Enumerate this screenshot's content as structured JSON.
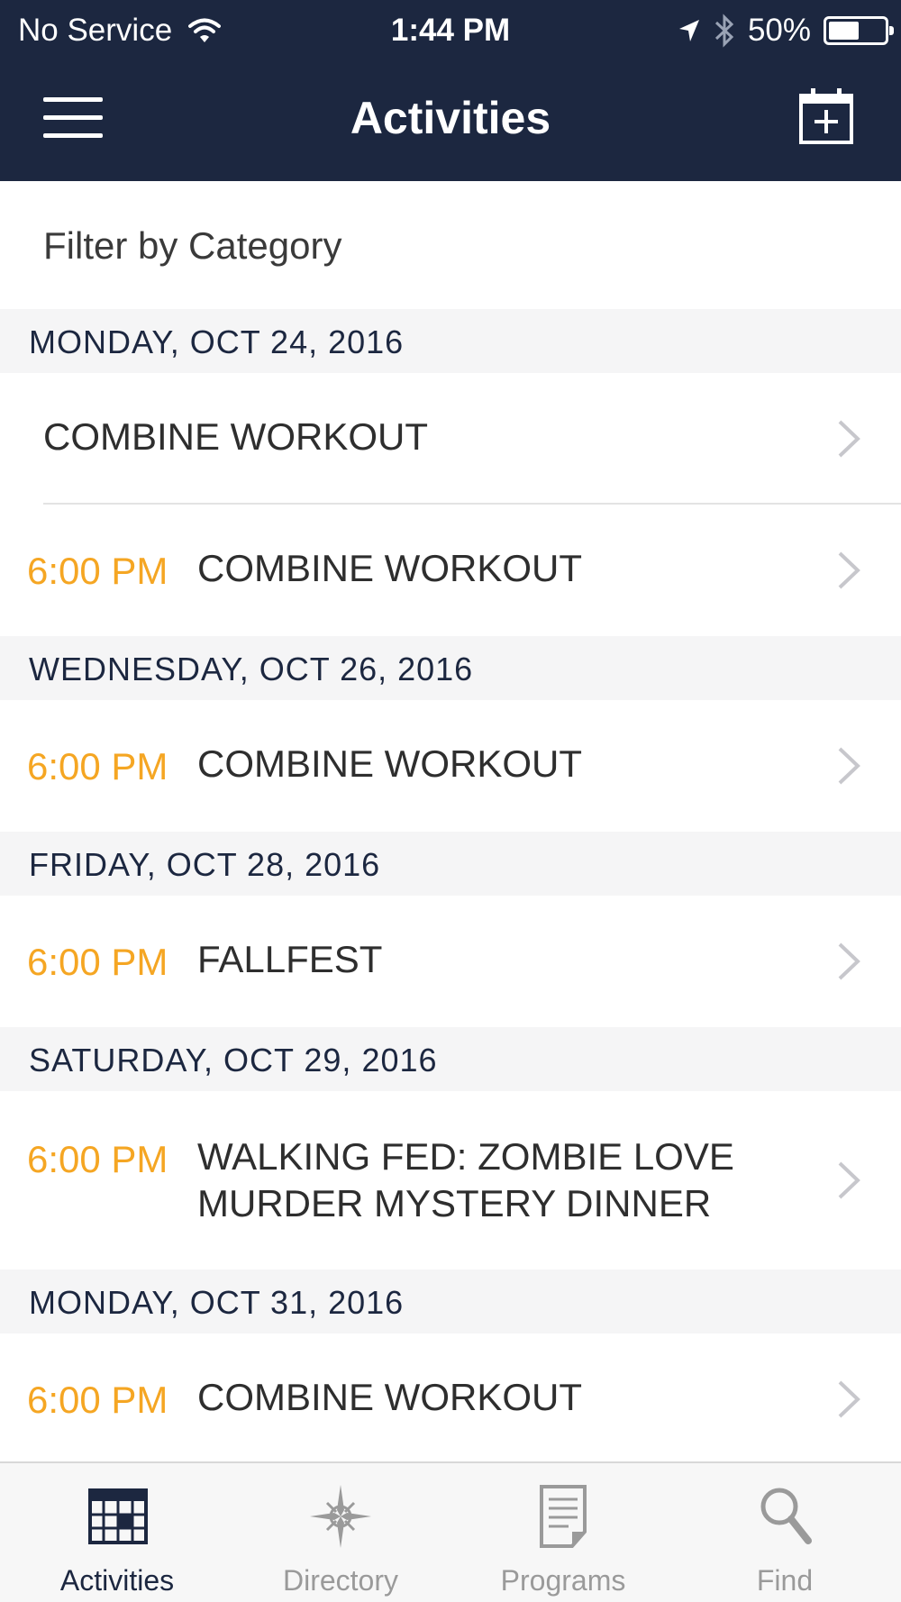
{
  "status_bar": {
    "carrier": "No Service",
    "time": "1:44 PM",
    "battery": "50%"
  },
  "nav": {
    "title": "Activities"
  },
  "filter": {
    "label": "Filter by Category"
  },
  "sections": [
    {
      "date": "MONDAY, OCT 24, 2016",
      "events": [
        {
          "time": "",
          "title": "COMBINE WORKOUT"
        },
        {
          "time": "6:00 PM",
          "title": "COMBINE WORKOUT"
        }
      ]
    },
    {
      "date": "WEDNESDAY, OCT 26, 2016",
      "events": [
        {
          "time": "6:00 PM",
          "title": "COMBINE WORKOUT"
        }
      ]
    },
    {
      "date": "FRIDAY, OCT 28, 2016",
      "events": [
        {
          "time": "6:00 PM",
          "title": "FALLFEST"
        }
      ]
    },
    {
      "date": "SATURDAY, OCT 29, 2016",
      "events": [
        {
          "time": "6:00 PM",
          "title_line1": "WALKING FED: ZOMBIE LOVE",
          "title_line2": "MURDER MYSTERY DINNER"
        }
      ]
    },
    {
      "date": "MONDAY, OCT 31, 2016",
      "events": [
        {
          "time": "6:00 PM",
          "title": "COMBINE WORKOUT"
        }
      ]
    }
  ],
  "tabs": [
    {
      "label": "Activities",
      "icon": "calendar-icon",
      "active": true
    },
    {
      "label": "Directory",
      "icon": "compass-icon",
      "active": false
    },
    {
      "label": "Programs",
      "icon": "document-icon",
      "active": false
    },
    {
      "label": "Find",
      "icon": "search-icon",
      "active": false
    }
  ],
  "colors": {
    "header_bg": "#1c2740",
    "time_accent": "#f5a623",
    "section_bg": "#f5f5f6"
  }
}
